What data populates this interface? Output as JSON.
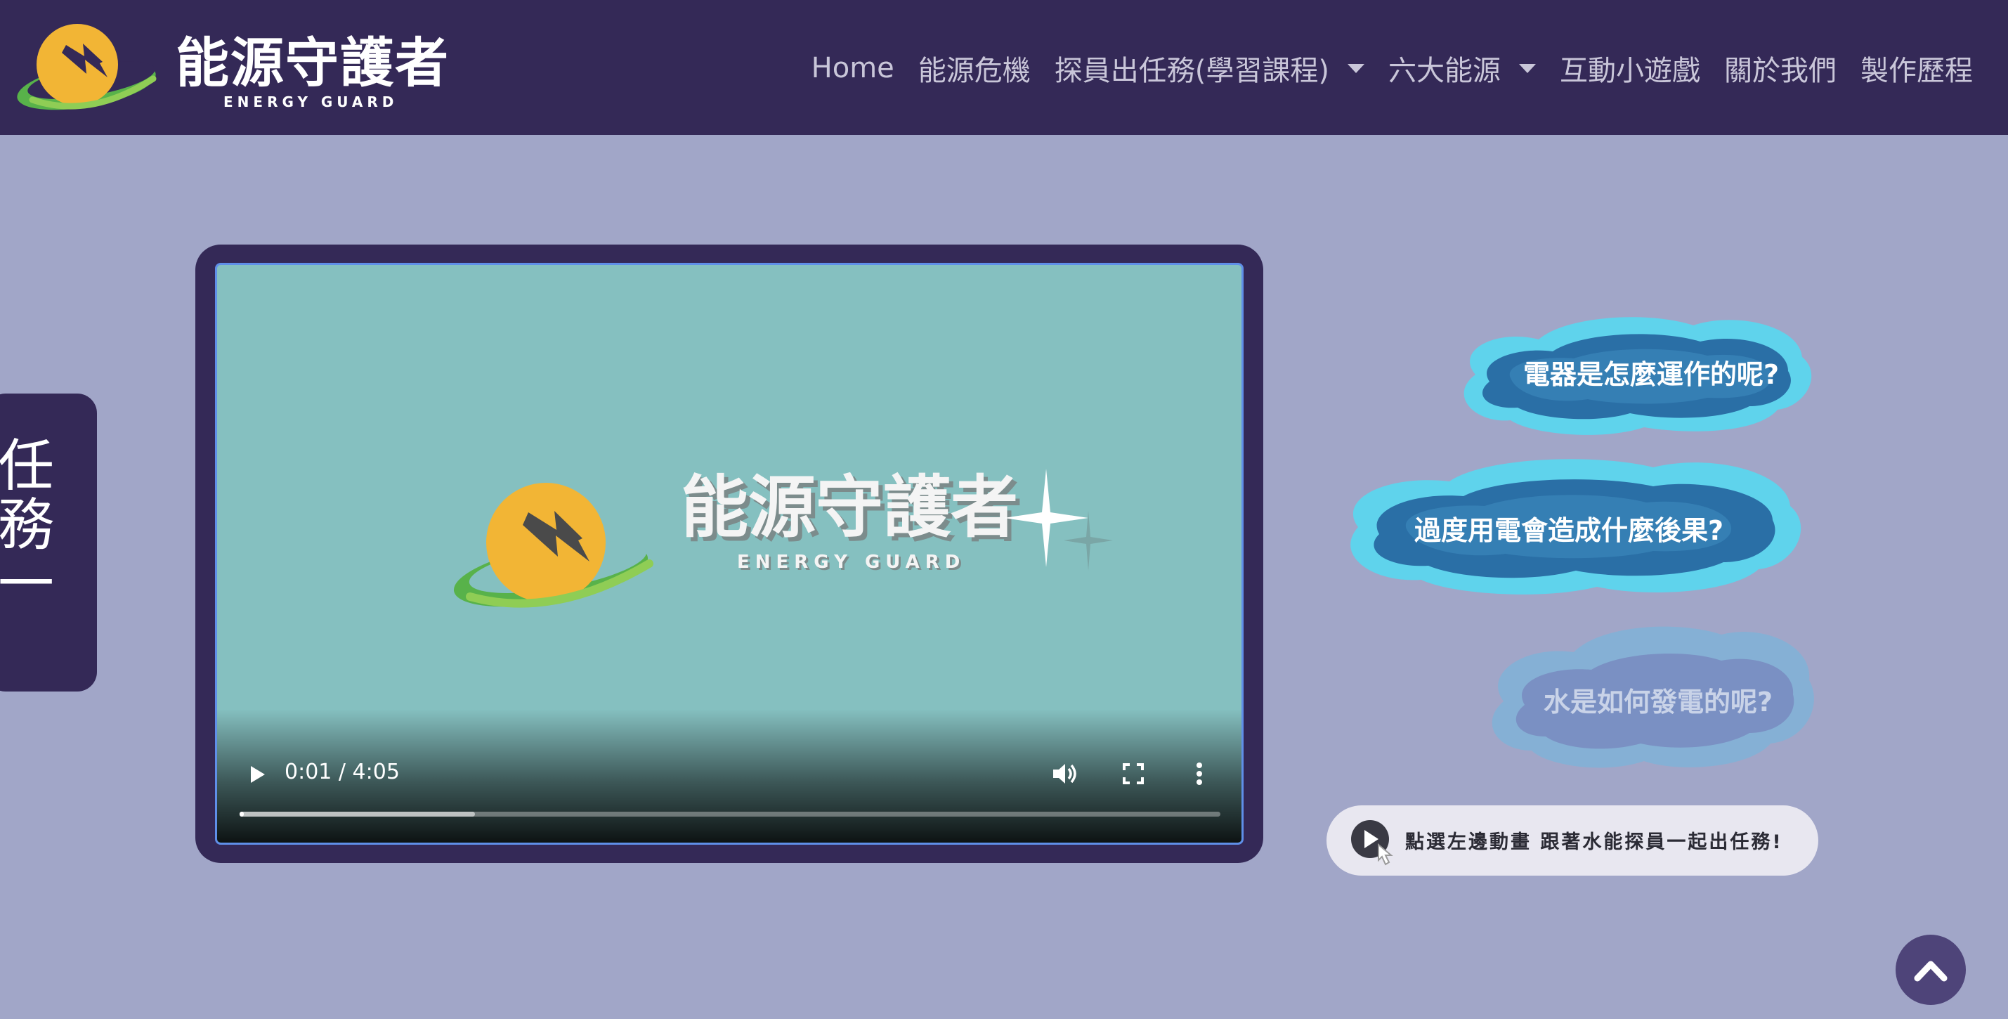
{
  "brand": {
    "title": "能源守護者",
    "subtitle": "ENERGY GUARD"
  },
  "nav": {
    "items": [
      {
        "label": "Home",
        "dropdown": false
      },
      {
        "label": "能源危機",
        "dropdown": false
      },
      {
        "label": "探員出任務(學習課程)",
        "dropdown": true
      },
      {
        "label": "六大能源",
        "dropdown": true
      },
      {
        "label": "互動小遊戲",
        "dropdown": false
      },
      {
        "label": "關於我們",
        "dropdown": false
      },
      {
        "label": "製作歷程",
        "dropdown": false
      }
    ]
  },
  "side_tab": {
    "label": "任務一"
  },
  "video": {
    "title": "能源守護者",
    "subtitle": "ENERGY GUARD",
    "current_time": "0:01",
    "duration": "4:05",
    "time_text": "0:01 / 4:05",
    "buffered_fraction": 0.24,
    "played_fraction": 0.004,
    "icons": [
      "play-icon",
      "volume-icon",
      "fullscreen-icon",
      "more-options-icon"
    ]
  },
  "questions": [
    {
      "label": "電器是怎麼運作的呢?",
      "state": "normal"
    },
    {
      "label": "過度用電會造成什麼後果?",
      "state": "normal"
    },
    {
      "label": "水是如何發電的呢?",
      "state": "faded"
    }
  ],
  "hint": {
    "text": "點選左邊動畫 跟著水能探員一起出任務!",
    "icon": "play-cursor-icon"
  },
  "back_to_top": {
    "icon": "chevron-up-icon"
  },
  "colors": {
    "navbar": "#342957",
    "background": "#a1a6c8",
    "video_bg": "#85c0c0",
    "cloud_light": "#5fd3ec",
    "cloud_dark": "#2a6fa6",
    "logo_sun": "#f2b535",
    "logo_swoosh": "#58b24a"
  }
}
